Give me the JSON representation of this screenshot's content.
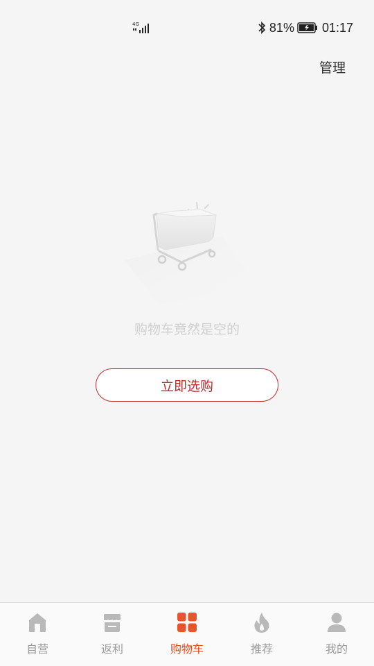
{
  "status_bar": {
    "network_label": "4G",
    "battery_percent": "81%",
    "time": "01:17",
    "icons": [
      "signal-icon",
      "bluetooth-icon",
      "battery-icon"
    ]
  },
  "header": {
    "manage_label": "管理"
  },
  "empty_state": {
    "message": "购物车竟然是空的",
    "button_label": "立即选购",
    "illustration": "empty-cart-icon"
  },
  "tab_bar": {
    "tabs": [
      {
        "label": "自营",
        "icon": "home-icon",
        "active": false
      },
      {
        "label": "返利",
        "icon": "store-icon",
        "active": false
      },
      {
        "label": "购物车",
        "icon": "grid-icon",
        "active": true
      },
      {
        "label": "推荐",
        "icon": "flame-icon",
        "active": false
      },
      {
        "label": "我的",
        "icon": "person-icon",
        "active": false
      }
    ]
  },
  "colors": {
    "accent": "#c42a2a",
    "active_tab": "#e64a19",
    "inactive_tab": "#9a9a9a",
    "background": "#f5f5f5"
  }
}
